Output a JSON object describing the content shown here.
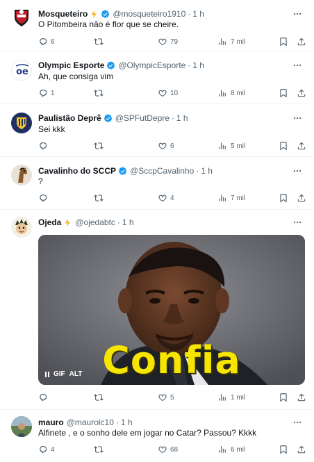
{
  "colors": {
    "verified": "#1d9bf0",
    "lightning": "#f5b82e",
    "muted": "#536471",
    "text": "#0f1419",
    "divider": "#eff3f4",
    "caption": "#f5e500"
  },
  "tweets": [
    {
      "name": "Mosqueteiro",
      "handle": "@mosqueteiro1910",
      "dot": "·",
      "time": "1 h",
      "text": "O Pitombeira não é flor que se cheire.",
      "replies": "6",
      "retweets": "",
      "likes": "79",
      "views": "7 mil",
      "icons": [
        "lightning-icon",
        "verified-badge-icon"
      ]
    },
    {
      "name": "Olympic Esporte",
      "handle": "@OlympicEsporte",
      "dot": "·",
      "time": "1 h",
      "text": "Ah, que consiga vim",
      "replies": "1",
      "retweets": "",
      "likes": "10",
      "views": "8 mil",
      "icons": [
        "verified-badge-icon"
      ]
    },
    {
      "name": "Paulistão Deprê",
      "handle": "@SPFutDepre",
      "dot": "·",
      "time": "1 h",
      "text": "Sei kkk",
      "replies": "",
      "retweets": "",
      "likes": "6",
      "views": "5 mil",
      "icons": [
        "verified-badge-icon"
      ]
    },
    {
      "name": "Cavalinho do SCCP",
      "handle": "@SccpCavalinho",
      "dot": "·",
      "time": "1 h",
      "text": "?",
      "replies": "",
      "retweets": "",
      "likes": "4",
      "views": "7 mil",
      "icons": [
        "verified-badge-icon"
      ]
    },
    {
      "name": "Ojeda",
      "handle": "@ojedabtc",
      "dot": "·",
      "time": "1 h",
      "text": "",
      "replies": "",
      "retweets": "",
      "likes": "5",
      "views": "1 mil",
      "icons": [
        "lightning-icon"
      ],
      "media": {
        "caption": "Confia",
        "gif_label": "GIF",
        "alt_label": "ALT"
      }
    },
    {
      "name": "mauro",
      "handle": "@maurolc10",
      "dot": "·",
      "time": "1 h",
      "text": "Alfinete , e o sonho dele em jogar no Catar? Passou? Kkkk",
      "replies": "4",
      "retweets": "",
      "likes": "68",
      "views": "6 mil",
      "icons": []
    }
  ]
}
